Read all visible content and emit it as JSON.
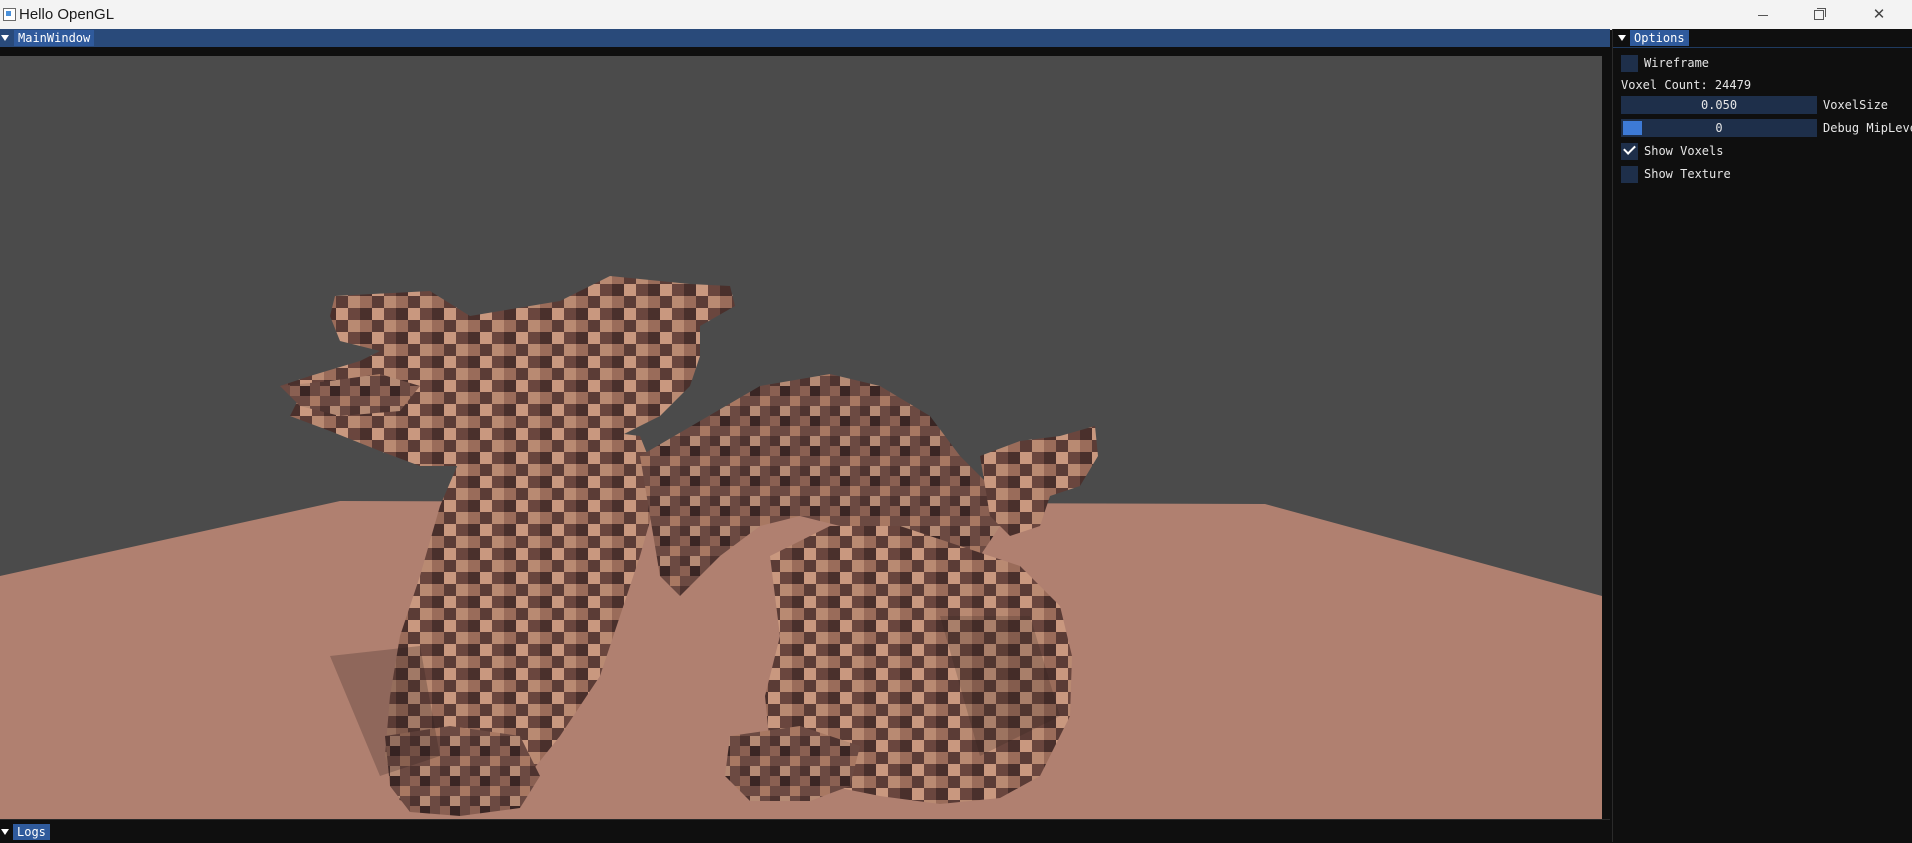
{
  "os_window": {
    "title": "Hello OpenGL"
  },
  "main_window": {
    "title": "MainWindow"
  },
  "options": {
    "title": "Options",
    "wireframe_label": "Wireframe",
    "wireframe_checked": false,
    "voxel_count_label": "Voxel Count: 24479",
    "voxel_size_value": "0.050",
    "voxel_size_label": "VoxelSize",
    "mip_level_value": "0",
    "mip_level_label": "Debug MipLeve",
    "show_voxels_label": "Show Voxels",
    "show_voxels_checked": true,
    "show_texture_label": "Show Texture",
    "show_texture_checked": false
  },
  "logs": {
    "title": "Logs"
  },
  "colors": {
    "accent": "#2f5a9c",
    "title_bg": "#294a7a",
    "frame_bg": "#1e2f4a",
    "slider_grab": "#3d7ad6",
    "sky": "#4b4b4b",
    "floor": "#b08070",
    "voxel_dark": "#3a2624",
    "voxel_light": "#c9987f"
  },
  "icons": [
    "window-app-icon",
    "minimize-icon",
    "maximize-icon",
    "close-icon",
    "collapse-triangle-icon",
    "checkmark-icon"
  ]
}
